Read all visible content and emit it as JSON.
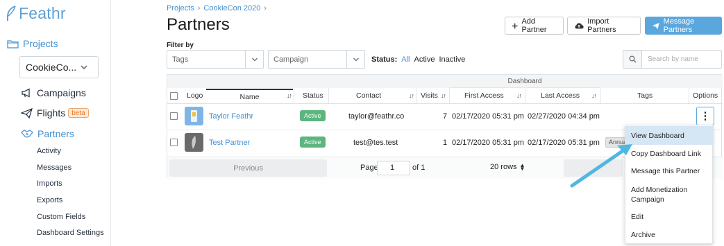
{
  "brand": {
    "logo_text": "Feathr",
    "accent": "#3f8ed0",
    "success": "#5cb57f"
  },
  "sidebar": {
    "projects_label": "Projects",
    "project_select": "CookieCo...",
    "items": [
      {
        "label": "Campaigns",
        "icon": "megaphone-icon"
      },
      {
        "label": "Flights",
        "icon": "paper-plane-icon",
        "badge": "beta"
      },
      {
        "label": "Partners",
        "icon": "handshake-icon",
        "active": true
      }
    ],
    "subitems": [
      "Activity",
      "Messages",
      "Imports",
      "Exports",
      "Custom Fields",
      "Dashboard Settings"
    ]
  },
  "breadcrumb": {
    "items": [
      "Projects",
      "CookieCon 2020"
    ]
  },
  "page_title": "Partners",
  "header_buttons": {
    "add": "Add Partner",
    "import": "Import Partners",
    "message": "Message Partners"
  },
  "filters": {
    "label": "Filter by",
    "tags_placeholder": "Tags",
    "campaign_placeholder": "Campaign",
    "status_label": "Status:",
    "status_options": [
      "All",
      "Active",
      "Inactive"
    ],
    "search_placeholder": "Search by name"
  },
  "table": {
    "dashboard_group": "Dashboard",
    "columns": {
      "logo": "Logo",
      "name": "Name",
      "status": "Status",
      "contact": "Contact",
      "visits": "Visits",
      "first_access": "First Access",
      "last_access": "Last Access",
      "tags": "Tags",
      "options": "Options"
    },
    "rows": [
      {
        "name": "Taylor Feathr",
        "status": "Active",
        "contact": "taylor@feathr.co",
        "visits": "7",
        "first_access": "02/17/2020 05:31 pm",
        "last_access": "02/27/2020 04:34 pm",
        "tag": ""
      },
      {
        "name": "Test Partner",
        "status": "Active",
        "contact": "test@tes.test",
        "visits": "1",
        "first_access": "02/17/2020 05:31 pm",
        "last_access": "02/17/2020 05:31 pm",
        "tag": "Annual"
      }
    ],
    "options_glyph": "⋮"
  },
  "pagination": {
    "previous": "Previous",
    "page_label": "Page",
    "page_value": "1",
    "of_label": "of 1",
    "rows_label": "20 rows"
  },
  "options_menu": {
    "items": [
      "View Dashboard",
      "Copy Dashboard Link",
      "Message this Partner",
      "Add Monetization Campaign",
      "Edit",
      "Archive"
    ],
    "highlighted": "View Dashboard"
  }
}
